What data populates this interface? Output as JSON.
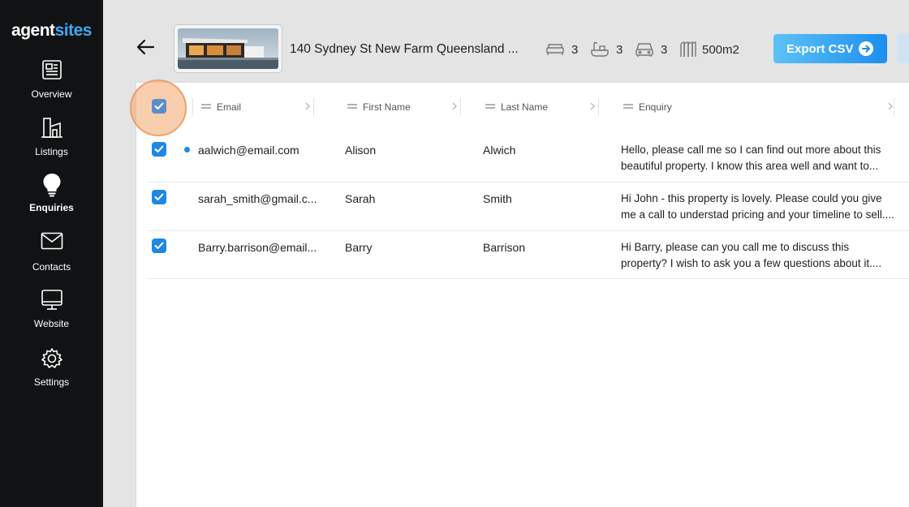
{
  "brand": {
    "part1": "agent",
    "part2": "sites"
  },
  "nav": [
    {
      "label": "Overview",
      "icon": "newspaper-icon"
    },
    {
      "label": "Listings",
      "icon": "buildings-icon"
    },
    {
      "label": "Enquiries",
      "icon": "lightbulb-icon",
      "active": true
    },
    {
      "label": "Contacts",
      "icon": "envelope-icon"
    },
    {
      "label": "Website",
      "icon": "monitor-icon"
    },
    {
      "label": "Settings",
      "icon": "gear-icon"
    }
  ],
  "listing": {
    "address": "140 Sydney St New Farm Queensland ...",
    "beds": "3",
    "baths": "3",
    "cars": "3",
    "area": "500m2"
  },
  "export_label": "Export CSV",
  "columns": [
    "Email",
    "First Name",
    "Last Name",
    "Enquiry"
  ],
  "rows": [
    {
      "checked": true,
      "unread": true,
      "email": "aalwich@email.com",
      "first": "Alison",
      "last": "Alwich",
      "enquiry_line1": "Hello, please call me so I can find out more about this",
      "enquiry_line2": "beautiful property. I know this area well and want to..."
    },
    {
      "checked": true,
      "unread": false,
      "email": "sarah_smith@gmail.c...",
      "first": "Sarah",
      "last": "Smith",
      "enquiry_line1": "Hi John - this property is lovely. Please could you give",
      "enquiry_line2": "me a call to understad pricing and your timeline to sell...."
    },
    {
      "checked": true,
      "unread": false,
      "email": "Barry.barrison@email...",
      "first": "Barry",
      "last": "Barrison",
      "enquiry_line1": "Hi Barry, please can you call me to discuss this",
      "enquiry_line2": "property? I wish to ask you a few questions about it...."
    }
  ],
  "colors": {
    "sidebar": "#111213",
    "accent": "#1e88e5",
    "brand_blue": "#3fa9f5",
    "highlight": "#efa06a"
  }
}
